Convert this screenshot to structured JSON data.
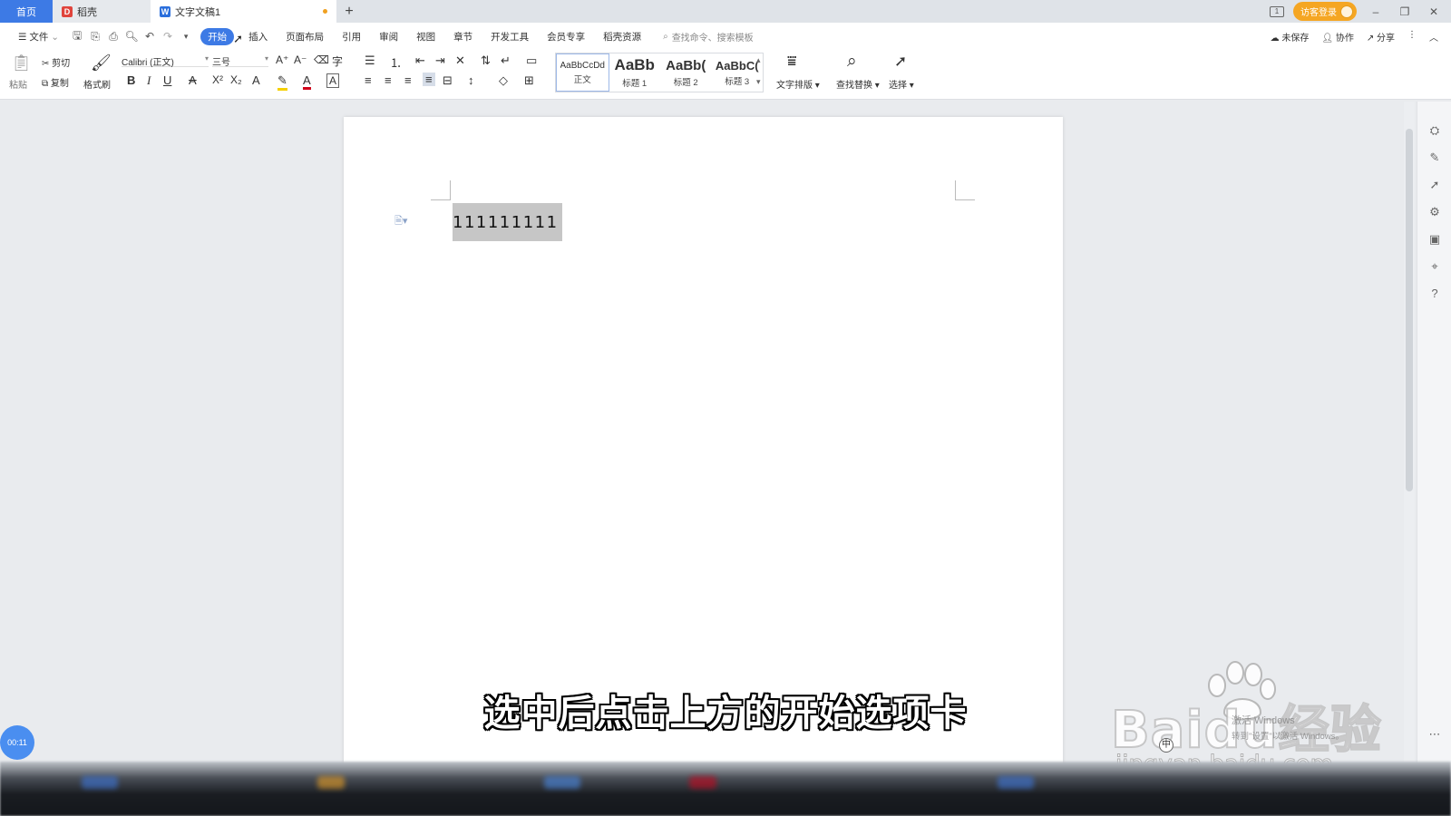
{
  "titlebar": {
    "tabs": [
      {
        "label": "首页",
        "icon": "home"
      },
      {
        "label": "稻壳",
        "icon": "daoke-logo-icon"
      },
      {
        "label": "文字文稿1",
        "icon": "wps-writer-icon"
      }
    ],
    "new_tab": "+",
    "login_label": "访客登录",
    "layout_icon": "1"
  },
  "menu": {
    "file_label": "文件",
    "tabs": [
      "开始",
      "插入",
      "页面布局",
      "引用",
      "审阅",
      "视图",
      "章节",
      "开发工具",
      "会员专享",
      "稻壳资源"
    ],
    "search_placeholder": "查找命令、搜索模板",
    "right": {
      "unsaved": "未保存",
      "collab": "协作",
      "share": "分享"
    }
  },
  "ribbon": {
    "paste": "粘贴",
    "cut": "剪切",
    "copy": "复制",
    "format_painter": "格式刷",
    "font_name": "Calibri (正文)",
    "font_size": "三号",
    "styles": [
      {
        "sample": "AaBbCcDd",
        "name": "正文"
      },
      {
        "sample": "AaBb",
        "name": "标题 1"
      },
      {
        "sample": "AaBb(",
        "name": "标题 2"
      },
      {
        "sample": "AaBbC(",
        "name": "标题 3"
      }
    ],
    "text_layout": "文字排版",
    "find_replace": "查找替换",
    "select": "选择"
  },
  "document": {
    "selected_text": "111111111"
  },
  "overlay": {
    "subtitle": "选中后点击上方的开始选项卡",
    "timer": "00:11",
    "watermark_brand": "Baidu经验",
    "watermark_url": "jingyan.baidu.com",
    "activate_title": "激活 Windows",
    "activate_sub": "转到\"设置\"以激活 Windows。",
    "ime_label": "中"
  },
  "colors": {
    "accent": "#3d7ae5",
    "login": "#f5a623",
    "selection": "#c6c6c6"
  }
}
